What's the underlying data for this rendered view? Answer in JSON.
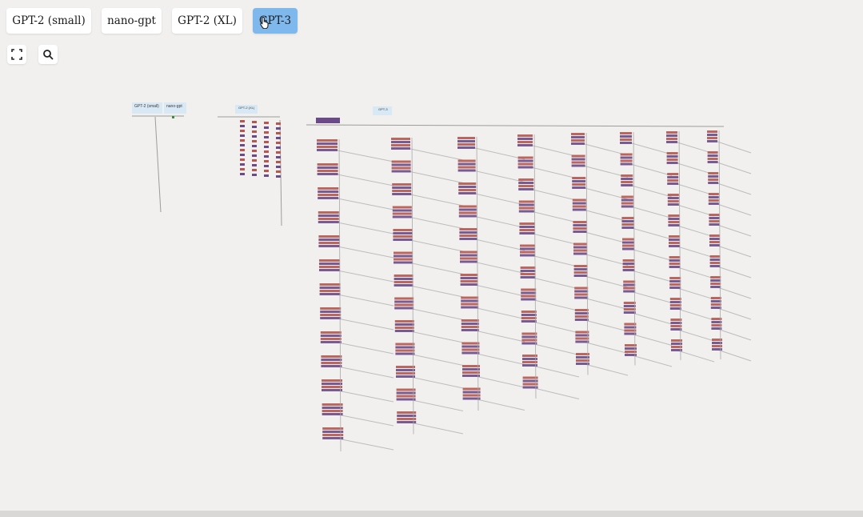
{
  "model_selector": {
    "options": [
      "GPT-2 (small)",
      "nano-gpt",
      "GPT-2 (XL)",
      "GPT-3"
    ],
    "selected": "GPT-3"
  },
  "controls": {
    "fullscreen_icon": "fullscreen-icon",
    "zoom_icon": "search-icon"
  },
  "visualization": {
    "labels": {
      "gpt2_small": "GPT-2 (small)",
      "nano_gpt": "nano-gpt",
      "gpt2_xl": "GPT-2 (XL)",
      "gpt3": "GPT-3"
    },
    "colors": {
      "block_a": "#6b4a8a",
      "block_b": "#b7574f",
      "line": "#9c9c9c",
      "label_bg": "#d8e8f5"
    }
  }
}
